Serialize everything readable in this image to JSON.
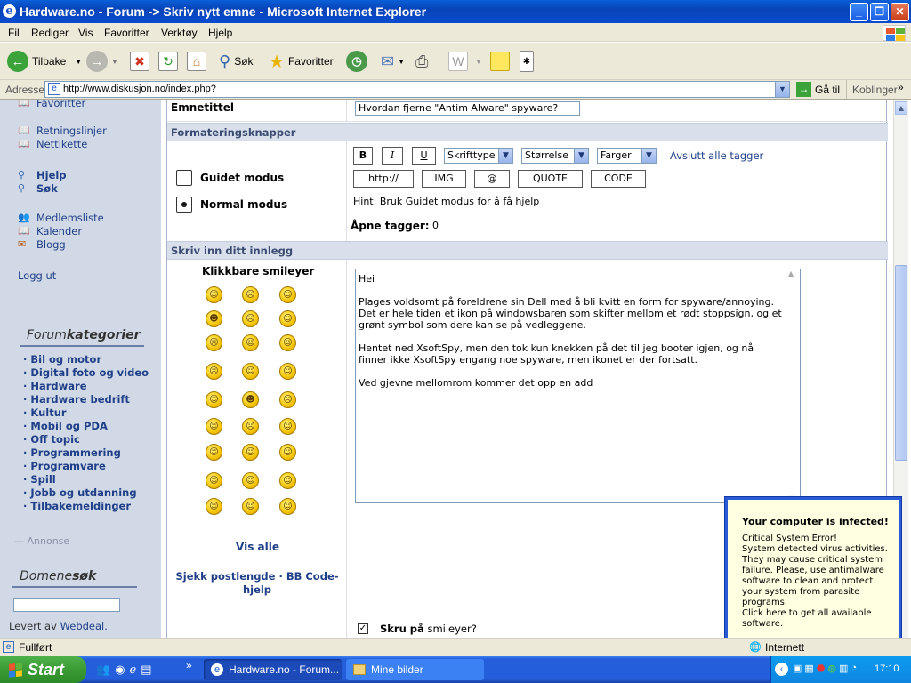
{
  "window": {
    "title": "Hardware.no - Forum -> Skriv nytt emne - Microsoft Internet Explorer"
  },
  "menu": [
    "Fil",
    "Rediger",
    "Vis",
    "Favoritter",
    "Verktøy",
    "Hjelp"
  ],
  "toolbar": {
    "back": "Tilbake",
    "search": "Søk",
    "favorites": "Favoritter"
  },
  "address": {
    "label": "Adresse",
    "url": "http://www.diskusjon.no/index.php?",
    "go": "Gå til",
    "links": "Koblinger"
  },
  "sidebar": {
    "top_partial": "Favoritter",
    "links1": [
      "Retningslinjer",
      "Nettikette"
    ],
    "links2": [
      "Hjelp",
      "Søk"
    ],
    "links3": [
      "Medlemsliste",
      "Kalender",
      "Blogg"
    ],
    "logout": "Logg ut",
    "cat_title_a": "Forum",
    "cat_title_b": "kategorier",
    "categories": [
      "· Bil og motor",
      "· Digital foto og video",
      "· Hardware",
      "· Hardware bedrift",
      "· Kultur",
      "· Mobil og PDA",
      "· Off topic",
      "· Programmering",
      "· Programvare",
      "· Spill",
      "· Jobb og utdanning",
      "· Tilbakemeldinger"
    ],
    "annonse": "— Annonse",
    "domain_a": "Domene",
    "domain_b": "søk",
    "supplied_by": "Levert av",
    "supplier": "Webdeal."
  },
  "form": {
    "subject_label": "Emnetittel",
    "subject_value": "Hvordan fjerne \"Antim Alware\" spyware?",
    "format_header": "Formateringsknapper",
    "bold": "B",
    "italic": "I",
    "underline": "U",
    "font_select": "Skrifttype",
    "size_select": "Størrelse",
    "color_select": "Farger",
    "close_tags": "Avslutt alle tagger",
    "guided_mode": "Guidet modus",
    "normal_mode": "Normal modus",
    "btn_http": "http://",
    "btn_img": "IMG",
    "btn_at": "@",
    "btn_quote": "QUOTE",
    "btn_code": "CODE",
    "hint": "Hint: Bruk Guidet modus for å få hjelp",
    "open_tags_label": "Åpne tagger:",
    "open_tags_value": "0",
    "post_header": "Skriv inn ditt innlegg",
    "smileys_title": "Klikkbare smileyer",
    "show_all": "Vis alle",
    "check_length": "Sjekk postlengde · BB Code-hjelp",
    "post_text": "Hei\n\nPlages voldsomt på foreldrene sin Dell med å bli kvitt en form for spyware/annoying. Det er hele tiden et ikon på windowsbaren som skifter mellom et rødt stoppsign, og et grønt symbol som dere kan se på vedleggene.\n\nHentet ned XsoftSpy, men den tok kun knekken på det til jeg booter igjen, og nå finner ikke XsoftSpy engang noe spyware, men ikonet er der fortsatt.\n\nVed gjevne mellomrom kommer det opp en add",
    "enable_smileys_bold": "Skru på",
    "enable_smileys_rest": "smileyer?"
  },
  "popup": {
    "title": "Your computer is infected!",
    "body": "Critical System Error!\nSystem detected virus activities. They may cause critical system failure. Please, use antimalware software to clean and protect your system from parasite programs.\nClick here to get all available software."
  },
  "status": {
    "text": "Fullført",
    "zone": "Internett"
  },
  "taskbar": {
    "start": "Start",
    "task1": "Hardware.no - Forum...",
    "task2": "Mine bilder",
    "clock": "17:10"
  },
  "colors": {
    "xp_blue": "#245edb",
    "start_green": "#3a9a34",
    "sidebar_bg": "#d1d9e6",
    "header_bg": "#d9e0ec",
    "popup_bg": "#ffffe1",
    "link_blue": "#1f3f88"
  }
}
